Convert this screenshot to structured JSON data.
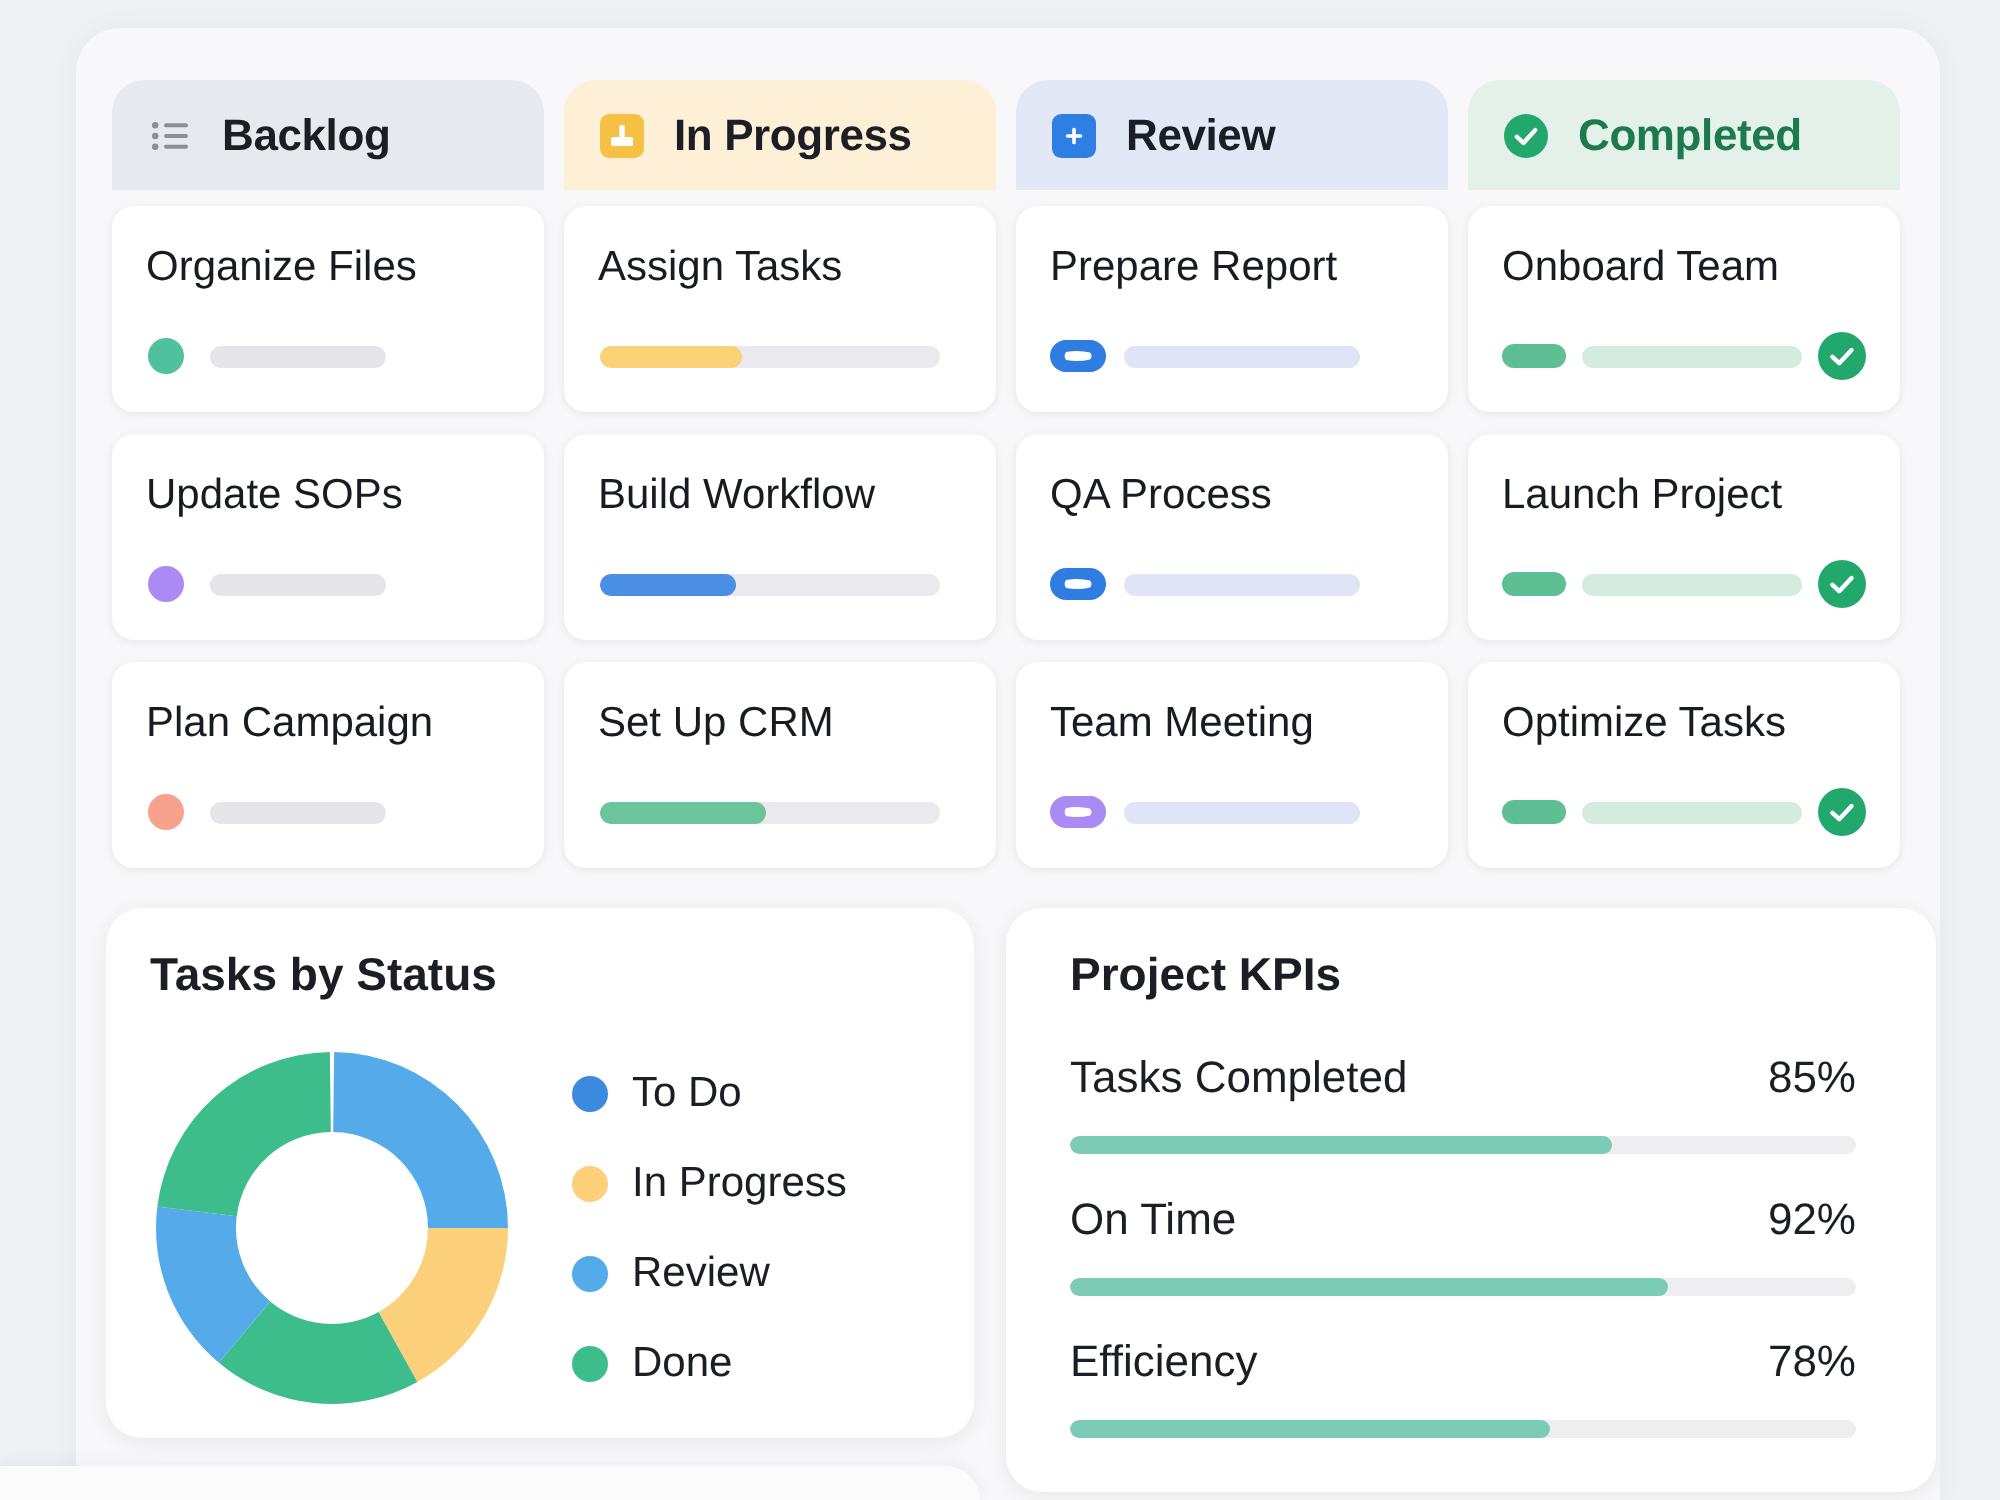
{
  "board": {
    "columns": [
      {
        "kind": "backlog",
        "title": "Backlog",
        "cards": [
          {
            "title": "Organize Files",
            "color": "#4fc19c"
          },
          {
            "title": "Update SOPs",
            "color": "#a98bf3"
          },
          {
            "title": "Plan Campaign",
            "color": "#f7a28c"
          }
        ]
      },
      {
        "kind": "progress",
        "title": "In Progress",
        "cards": [
          {
            "title": "Assign Tasks",
            "color": "#fcd278",
            "level": 0.42
          },
          {
            "title": "Build Workflow",
            "color": "#4a8fe3",
            "level": 0.4
          },
          {
            "title": "Set Up CRM",
            "color": "#6cc49a",
            "level": 0.49
          }
        ]
      },
      {
        "kind": "review",
        "title": "Review",
        "cards": [
          {
            "title": "Prepare Report",
            "color": "#2f7de1"
          },
          {
            "title": "QA Process",
            "color": "#2f7de1"
          },
          {
            "title": "Team Meeting",
            "color": "#a98bf3"
          }
        ]
      },
      {
        "kind": "done",
        "title": "Completed",
        "cards": [
          {
            "title": "Onboard Team"
          },
          {
            "title": "Launch Project"
          },
          {
            "title": "Optimize Tasks"
          }
        ]
      }
    ]
  },
  "status_chart": {
    "title": "Tasks by Status",
    "legend": [
      {
        "label": "To Do",
        "color": "#3b8ae0"
      },
      {
        "label": "In Progress",
        "color": "#fcd07a"
      },
      {
        "label": "Review",
        "color": "#55abe9"
      },
      {
        "label": "Done",
        "color": "#3dbd8b"
      }
    ]
  },
  "kpis": {
    "title": "Project KPIs",
    "items": [
      {
        "label": "Tasks Completed",
        "value": "85%",
        "level": 0.69
      },
      {
        "label": "On Time",
        "value": "92%",
        "level": 0.76
      },
      {
        "label": "Efficiency",
        "value": "78%",
        "level": 0.61
      }
    ]
  }
}
